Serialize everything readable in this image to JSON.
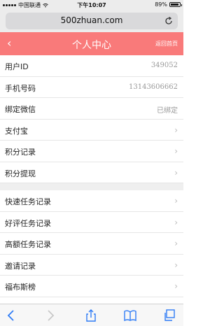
{
  "status": {
    "carrier": "中国联通",
    "time": "下午10:07",
    "battery": "89%",
    "battery_level": 0.89
  },
  "browser": {
    "url": "500zhuan.com"
  },
  "header": {
    "back": "‹",
    "title": "个人中心",
    "home_link": "返回首页"
  },
  "group1": [
    {
      "label": "用户ID",
      "value": "349052"
    },
    {
      "label": "手机号码",
      "value": "13143606662"
    },
    {
      "label": "绑定微信",
      "value": "已绑定"
    },
    {
      "label": "支付宝"
    },
    {
      "label": "积分记录"
    },
    {
      "label": "积分提现"
    }
  ],
  "group2": [
    {
      "label": "快速任务记录"
    },
    {
      "label": "好评任务记录"
    },
    {
      "label": "高额任务记录"
    },
    {
      "label": "邀请记录"
    },
    {
      "label": "福布斯榜"
    }
  ],
  "chevron": "›",
  "toolbar": [
    "back-icon",
    "forward-icon",
    "share-icon",
    "bookmarks-icon",
    "tabs-icon"
  ]
}
